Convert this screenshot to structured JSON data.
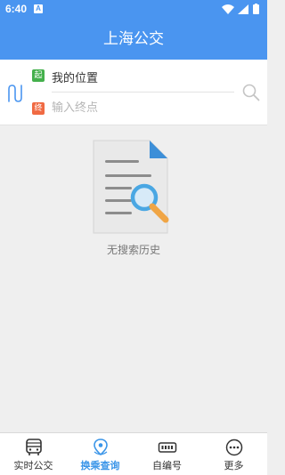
{
  "status_bar": {
    "time": "6:40",
    "notification_letter": "A"
  },
  "header": {
    "title": "上海公交"
  },
  "route_search": {
    "start_tag": "起",
    "start_value": "我的位置",
    "end_tag": "终",
    "end_placeholder": "输入终点",
    "end_value": ""
  },
  "empty_state": {
    "text": "无搜索历史"
  },
  "tabs": [
    {
      "label": "实时公交",
      "icon": "bus-icon",
      "active": false
    },
    {
      "label": "换乘查询",
      "icon": "location-pin-icon",
      "active": true
    },
    {
      "label": "自编号",
      "icon": "bus-number-icon",
      "active": false
    },
    {
      "label": "更多",
      "icon": "more-icon",
      "active": false
    }
  ],
  "colors": {
    "primary": "#4a95f0",
    "start_tag": "#44b04c",
    "end_tag": "#f06a43",
    "tab_active": "#3a95e8"
  }
}
